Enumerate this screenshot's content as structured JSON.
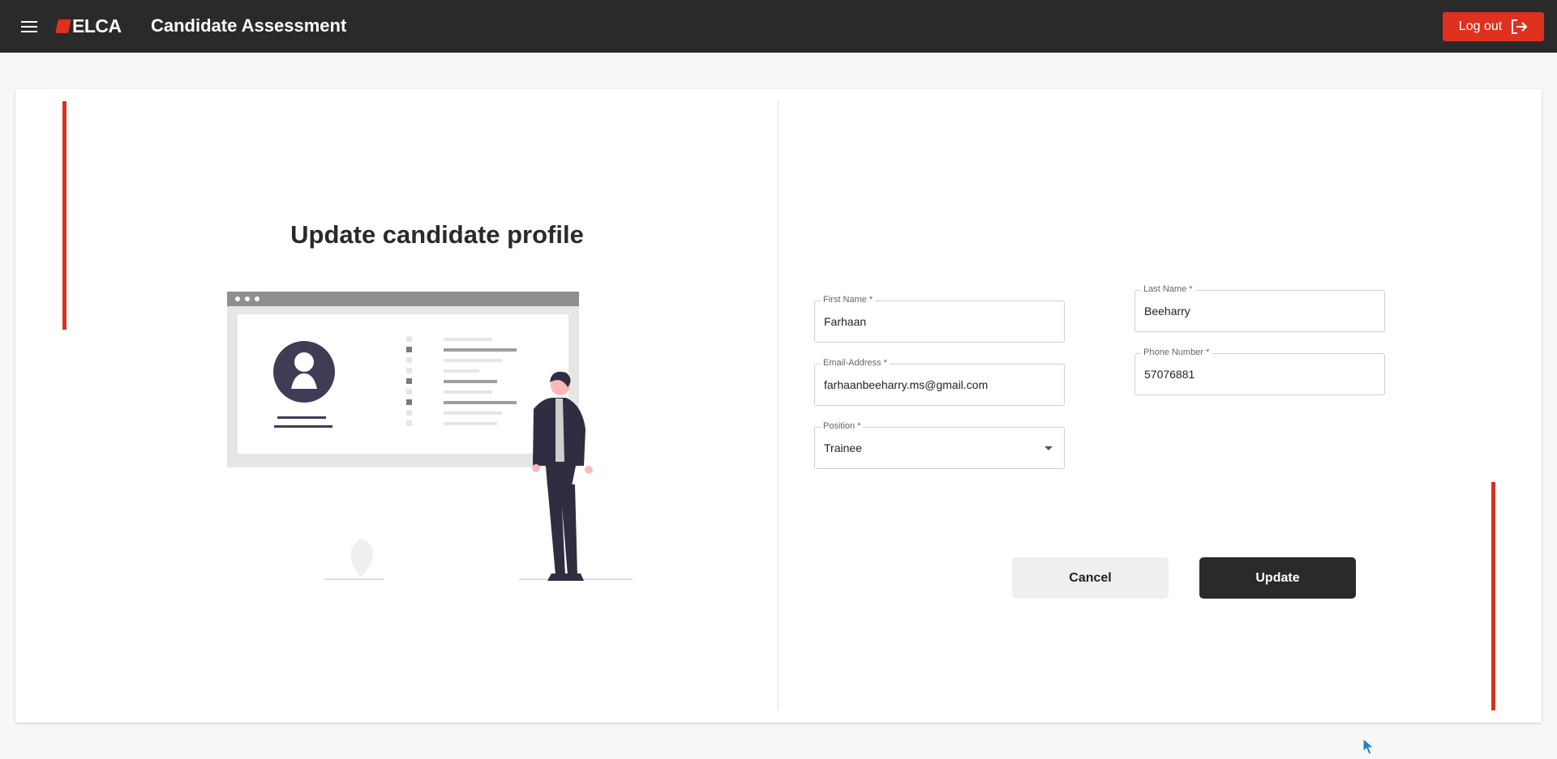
{
  "header": {
    "logo_text": "ELCA",
    "title": "Candidate Assessment",
    "logout_label": "Log out"
  },
  "page": {
    "heading": "Update candidate profile"
  },
  "form": {
    "first_name": {
      "label": "First Name *",
      "value": "Farhaan"
    },
    "last_name": {
      "label": "Last Name *",
      "value": "Beeharry"
    },
    "email": {
      "label": "Email-Address *",
      "value": "farhaanbeeharry.ms@gmail.com"
    },
    "phone": {
      "label": "Phone Number *",
      "value": "57076881"
    },
    "position": {
      "label": "Position *",
      "value": "Trainee"
    }
  },
  "actions": {
    "cancel_label": "Cancel",
    "update_label": "Update"
  },
  "colors": {
    "brand_red": "#e0301e",
    "header_dark": "#2a2a2b",
    "accent_bar": "#d5331f"
  },
  "icons": {
    "menu": "hamburger-menu-icon",
    "logout": "logout-icon",
    "dropdown": "chevron-down-icon",
    "cursor": "mouse-pointer-icon"
  }
}
